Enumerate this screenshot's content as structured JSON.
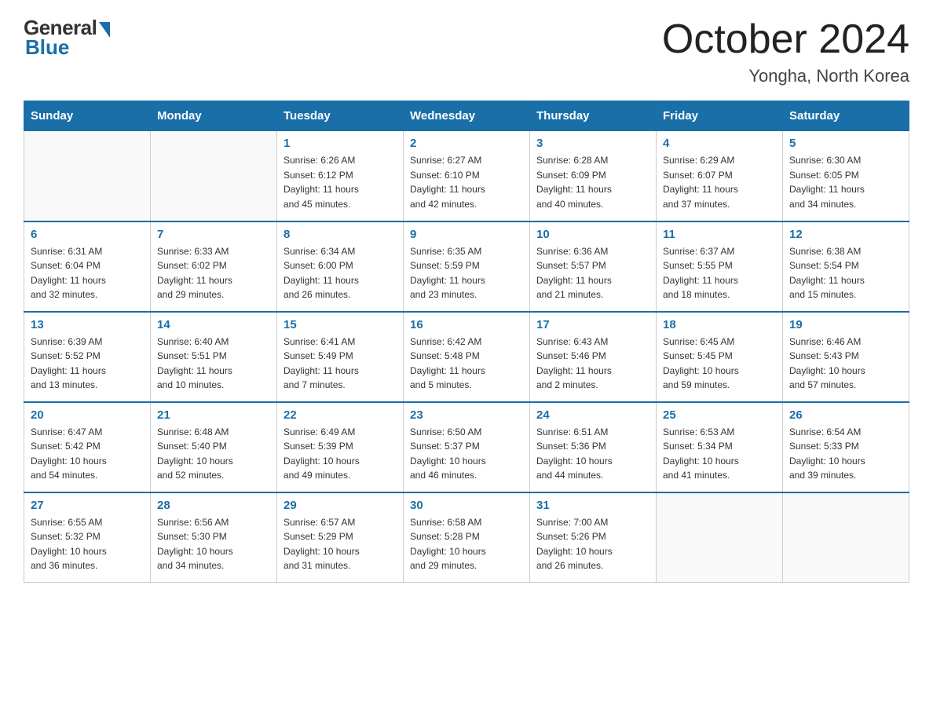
{
  "header": {
    "logo_general": "General",
    "logo_blue": "Blue",
    "month": "October 2024",
    "location": "Yongha, North Korea"
  },
  "weekdays": [
    "Sunday",
    "Monday",
    "Tuesday",
    "Wednesday",
    "Thursday",
    "Friday",
    "Saturday"
  ],
  "weeks": [
    [
      {
        "day": "",
        "info": ""
      },
      {
        "day": "",
        "info": ""
      },
      {
        "day": "1",
        "info": "Sunrise: 6:26 AM\nSunset: 6:12 PM\nDaylight: 11 hours\nand 45 minutes."
      },
      {
        "day": "2",
        "info": "Sunrise: 6:27 AM\nSunset: 6:10 PM\nDaylight: 11 hours\nand 42 minutes."
      },
      {
        "day": "3",
        "info": "Sunrise: 6:28 AM\nSunset: 6:09 PM\nDaylight: 11 hours\nand 40 minutes."
      },
      {
        "day": "4",
        "info": "Sunrise: 6:29 AM\nSunset: 6:07 PM\nDaylight: 11 hours\nand 37 minutes."
      },
      {
        "day": "5",
        "info": "Sunrise: 6:30 AM\nSunset: 6:05 PM\nDaylight: 11 hours\nand 34 minutes."
      }
    ],
    [
      {
        "day": "6",
        "info": "Sunrise: 6:31 AM\nSunset: 6:04 PM\nDaylight: 11 hours\nand 32 minutes."
      },
      {
        "day": "7",
        "info": "Sunrise: 6:33 AM\nSunset: 6:02 PM\nDaylight: 11 hours\nand 29 minutes."
      },
      {
        "day": "8",
        "info": "Sunrise: 6:34 AM\nSunset: 6:00 PM\nDaylight: 11 hours\nand 26 minutes."
      },
      {
        "day": "9",
        "info": "Sunrise: 6:35 AM\nSunset: 5:59 PM\nDaylight: 11 hours\nand 23 minutes."
      },
      {
        "day": "10",
        "info": "Sunrise: 6:36 AM\nSunset: 5:57 PM\nDaylight: 11 hours\nand 21 minutes."
      },
      {
        "day": "11",
        "info": "Sunrise: 6:37 AM\nSunset: 5:55 PM\nDaylight: 11 hours\nand 18 minutes."
      },
      {
        "day": "12",
        "info": "Sunrise: 6:38 AM\nSunset: 5:54 PM\nDaylight: 11 hours\nand 15 minutes."
      }
    ],
    [
      {
        "day": "13",
        "info": "Sunrise: 6:39 AM\nSunset: 5:52 PM\nDaylight: 11 hours\nand 13 minutes."
      },
      {
        "day": "14",
        "info": "Sunrise: 6:40 AM\nSunset: 5:51 PM\nDaylight: 11 hours\nand 10 minutes."
      },
      {
        "day": "15",
        "info": "Sunrise: 6:41 AM\nSunset: 5:49 PM\nDaylight: 11 hours\nand 7 minutes."
      },
      {
        "day": "16",
        "info": "Sunrise: 6:42 AM\nSunset: 5:48 PM\nDaylight: 11 hours\nand 5 minutes."
      },
      {
        "day": "17",
        "info": "Sunrise: 6:43 AM\nSunset: 5:46 PM\nDaylight: 11 hours\nand 2 minutes."
      },
      {
        "day": "18",
        "info": "Sunrise: 6:45 AM\nSunset: 5:45 PM\nDaylight: 10 hours\nand 59 minutes."
      },
      {
        "day": "19",
        "info": "Sunrise: 6:46 AM\nSunset: 5:43 PM\nDaylight: 10 hours\nand 57 minutes."
      }
    ],
    [
      {
        "day": "20",
        "info": "Sunrise: 6:47 AM\nSunset: 5:42 PM\nDaylight: 10 hours\nand 54 minutes."
      },
      {
        "day": "21",
        "info": "Sunrise: 6:48 AM\nSunset: 5:40 PM\nDaylight: 10 hours\nand 52 minutes."
      },
      {
        "day": "22",
        "info": "Sunrise: 6:49 AM\nSunset: 5:39 PM\nDaylight: 10 hours\nand 49 minutes."
      },
      {
        "day": "23",
        "info": "Sunrise: 6:50 AM\nSunset: 5:37 PM\nDaylight: 10 hours\nand 46 minutes."
      },
      {
        "day": "24",
        "info": "Sunrise: 6:51 AM\nSunset: 5:36 PM\nDaylight: 10 hours\nand 44 minutes."
      },
      {
        "day": "25",
        "info": "Sunrise: 6:53 AM\nSunset: 5:34 PM\nDaylight: 10 hours\nand 41 minutes."
      },
      {
        "day": "26",
        "info": "Sunrise: 6:54 AM\nSunset: 5:33 PM\nDaylight: 10 hours\nand 39 minutes."
      }
    ],
    [
      {
        "day": "27",
        "info": "Sunrise: 6:55 AM\nSunset: 5:32 PM\nDaylight: 10 hours\nand 36 minutes."
      },
      {
        "day": "28",
        "info": "Sunrise: 6:56 AM\nSunset: 5:30 PM\nDaylight: 10 hours\nand 34 minutes."
      },
      {
        "day": "29",
        "info": "Sunrise: 6:57 AM\nSunset: 5:29 PM\nDaylight: 10 hours\nand 31 minutes."
      },
      {
        "day": "30",
        "info": "Sunrise: 6:58 AM\nSunset: 5:28 PM\nDaylight: 10 hours\nand 29 minutes."
      },
      {
        "day": "31",
        "info": "Sunrise: 7:00 AM\nSunset: 5:26 PM\nDaylight: 10 hours\nand 26 minutes."
      },
      {
        "day": "",
        "info": ""
      },
      {
        "day": "",
        "info": ""
      }
    ]
  ]
}
